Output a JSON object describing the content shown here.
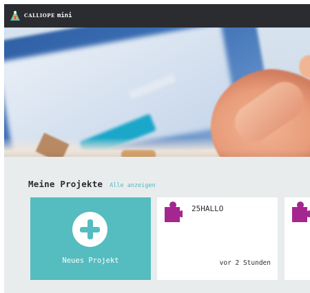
{
  "header": {
    "brand_small": "CALLIOPE",
    "brand_main": "mini"
  },
  "projects_section": {
    "title": "Meine Projekte",
    "show_all_link": "Alle anzeigen",
    "new_project_label": "Neues Projekt",
    "projects": [
      {
        "name": "25HALLO",
        "modified": "vor 2 Stunden"
      },
      {
        "name": "",
        "modified": ""
      }
    ]
  },
  "colors": {
    "topbar": "#2a2c30",
    "accent_teal": "#55bcbf",
    "puzzle_magenta": "#a3278f",
    "section_bg": "#e9eced"
  },
  "icons": {
    "logo": "calliope-logo-icon",
    "new_project": "plus-circle-icon",
    "project": "puzzle-piece-icon"
  }
}
